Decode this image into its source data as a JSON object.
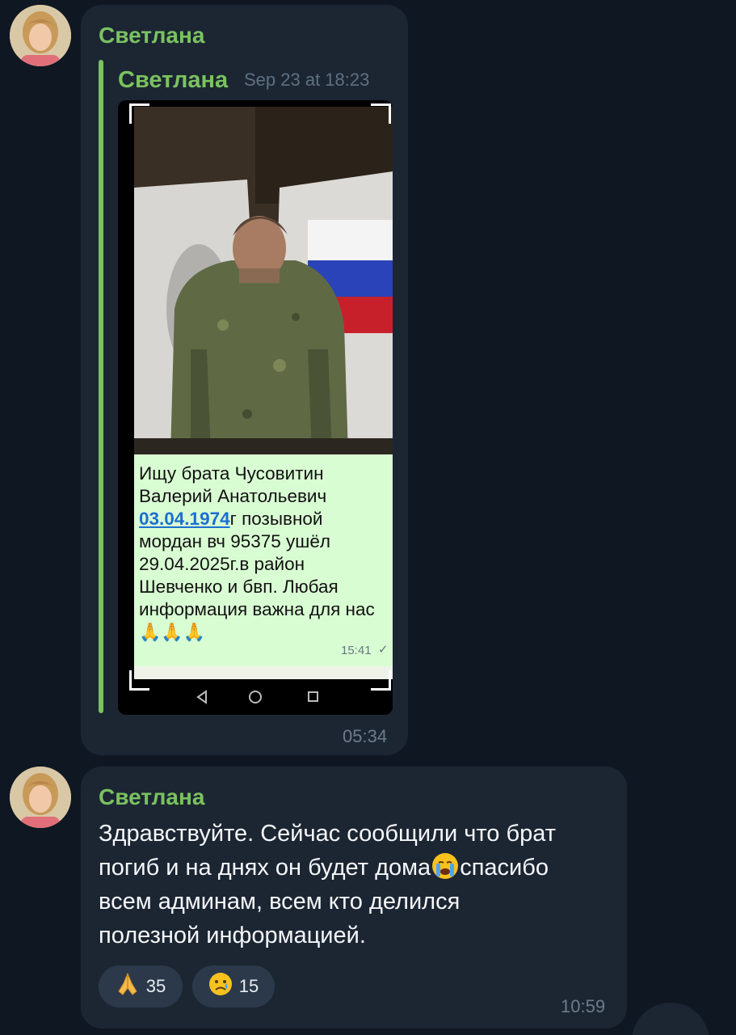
{
  "messages": [
    {
      "sender": "Светлана",
      "forwarded": {
        "sender": "Светлана",
        "date": "Sep 23 at 18:23",
        "screenshot": {
          "text_lines": [
            "Ищу брата Чусовитин",
            "Валерий Анатольевич",
            "позывной",
            "мордан вч 95375 ушёл",
            "29.04.2025г.в район",
            "Шевченко и бвп. Любая",
            "информация важна для нас"
          ],
          "date_link": "03.04.1974",
          "date_suffix": "г",
          "emoji": "🙏🙏🙏",
          "time": "15:41"
        }
      },
      "time": "05:34"
    },
    {
      "sender": "Светлана",
      "text_lines": [
        "Здравствуйте. Сейчас сообщили что брат",
        "погиб и на днях он будет дома",
        "спасибо",
        "всем админам, всем кто делился",
        "полезной информацией."
      ],
      "inline_emoji": "crying-face-icon",
      "reactions": [
        {
          "icon": "folded-hands-icon",
          "count": "35"
        },
        {
          "icon": "sad-tear-face-icon",
          "count": "15"
        }
      ],
      "time": "10:59"
    }
  ],
  "colors": {
    "background": "#0f1722",
    "bubble": "#1c2633",
    "accent_green": "#7ac25f",
    "link_blue": "#1a6fd1"
  }
}
